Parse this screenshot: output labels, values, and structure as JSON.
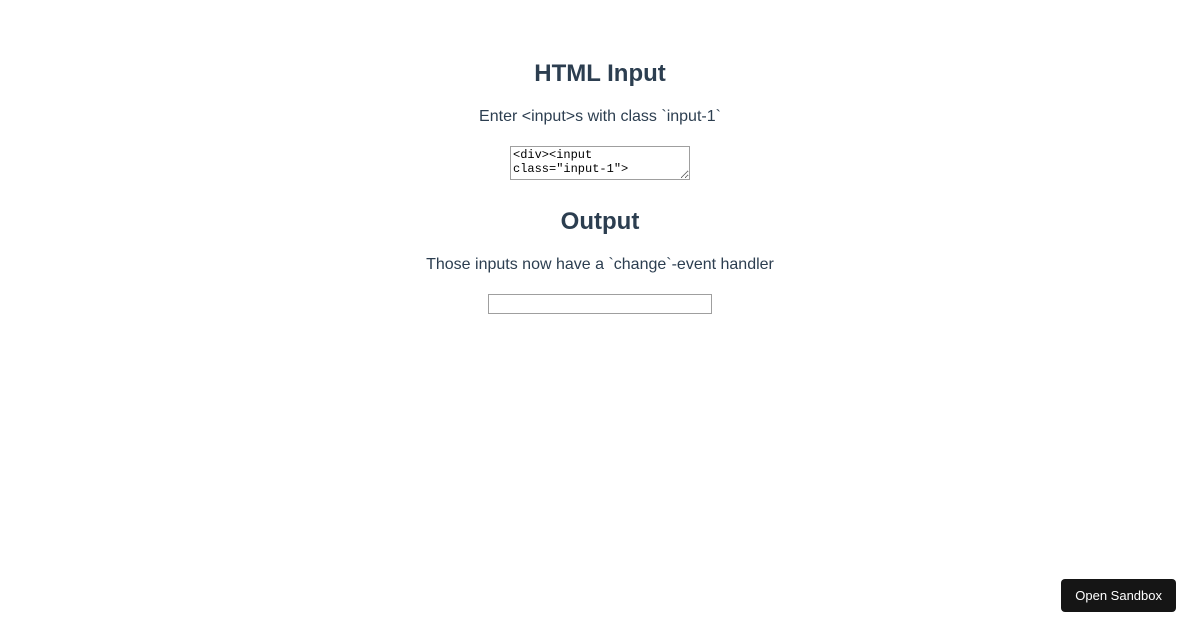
{
  "section1": {
    "heading": "HTML Input",
    "description": "Enter <input>s with class `input-1`",
    "textarea_value": "<div><input class=\"input-1\">"
  },
  "section2": {
    "heading": "Output",
    "description": "Those inputs now have a `change`-event handler",
    "input_value": ""
  },
  "footer": {
    "open_sandbox_label": "Open Sandbox"
  }
}
